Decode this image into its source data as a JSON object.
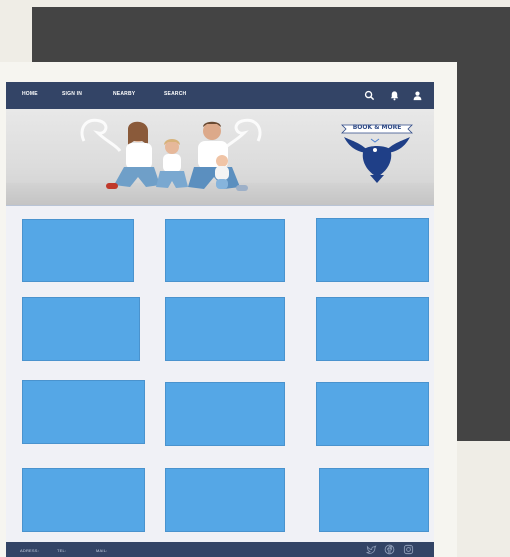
{
  "nav": {
    "items": [
      {
        "label": "HOME"
      },
      {
        "label": "SIGN IN"
      },
      {
        "label": "NEARBY"
      },
      {
        "label": "SEARCH"
      }
    ]
  },
  "hero": {
    "logo_text": "BOOK & MORE"
  },
  "footer": {
    "address_label": "ADRESS:",
    "tel_label": "TEL:",
    "mail_label": "MAIL:"
  },
  "icons": {
    "search": "search-icon",
    "bell": "bell-icon",
    "user": "user-icon",
    "twitter": "twitter-icon",
    "facebook": "facebook-icon",
    "instagram": "instagram-icon"
  },
  "colors": {
    "nav_bg": "#334466",
    "tile": "#55a7e6",
    "backdrop": "#444444",
    "page": "#efede6"
  }
}
